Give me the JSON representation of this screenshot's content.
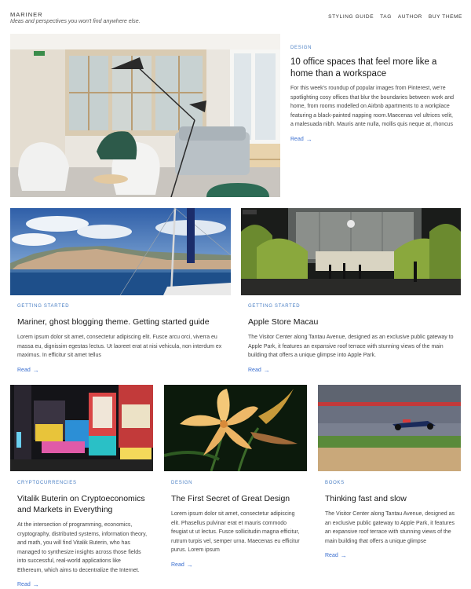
{
  "site": {
    "title": "MARINER",
    "tagline": "Ideas and perspectives you won't find anywhere else."
  },
  "nav": {
    "items": [
      "STYLING GUIDE",
      "TAG",
      "AUTHOR",
      "BUY THEME"
    ]
  },
  "posts": [
    {
      "category": "DESIGN",
      "title": "10 office spaces that feel more like a home than a workspace",
      "excerpt": "For this week's roundup of popular images from Pinterest, we're spotlighting cosy offices that blur the boundaries between work and home, from rooms modelled on Airbnb apartments to a workplace featuring a black-painted napping room.Maecenas vel ultrices velit, a malesuada nibh. Mauris ante nulla, mollis quis neque at, rhoncus",
      "read": "Read"
    },
    {
      "category": "GETTING STARTED",
      "title": "Mariner, ghost blogging theme. Getting started guide",
      "excerpt": "Lorem ipsum dolor sit amet, consectetur adipiscing elit. Fusce arcu orci, viverra eu massa eu, dignissim egestas lectus. Ut laoreet erat at nisi vehicula, non interdum ex maximus. In efficitur sit amet tellus",
      "read": "Read"
    },
    {
      "category": "GETTING STARTED",
      "title": "Apple Store Macau",
      "excerpt": "The Visitor Center along Tantau Avenue, designed as an exclusive public gateway to Apple Park, it features an expansive roof terrace with stunning views of the main building that offers a unique glimpse into Apple Park.",
      "read": "Read"
    },
    {
      "category": "CRYPTOCURRENCIES",
      "title": "Vitalik Buterin on Cryptoeconomics and Markets in Everything",
      "excerpt": "At the intersection of programming, economics, cryptography, distributed systems, information theory, and math, you will find Vitalik Buterin, who has managed to synthesize insights across those fields into successful, real-world applications like Ethereum, which aims to decentralize the Internet.",
      "read": "Read"
    },
    {
      "category": "DESIGN",
      "title": "The First Secret of Great Design",
      "excerpt": "Lorem ipsum dolor sit amet, consectetur adipiscing elit. Phasellus pulvinar erat et mauris commodo feugiat ut ut lectus. Fusce sollicitudin magna efficitur, rutrum turpis vel, semper urna. Maecenas eu efficitur purus. Lorem ipsum",
      "read": "Read"
    },
    {
      "category": "BOOKS",
      "title": "Thinking fast and slow",
      "excerpt": "The Visitor Center along Tantau Avenue, designed as an exclusive public gateway to Apple Park, it features an expansive roof terrace with stunning views of the main building that offers a unique glimpse",
      "read": "Read"
    }
  ],
  "images": {
    "post0": "office interior with lamp and chairs",
    "post1": "harbour town with sailboat mast",
    "post2": "apple store with bamboo at night",
    "post3": "city billboards at night",
    "post4": "orange lily flower",
    "post5": "racing car on track"
  },
  "colors": {
    "accent": "#3b6fd0",
    "category": "#4a7fc4"
  }
}
